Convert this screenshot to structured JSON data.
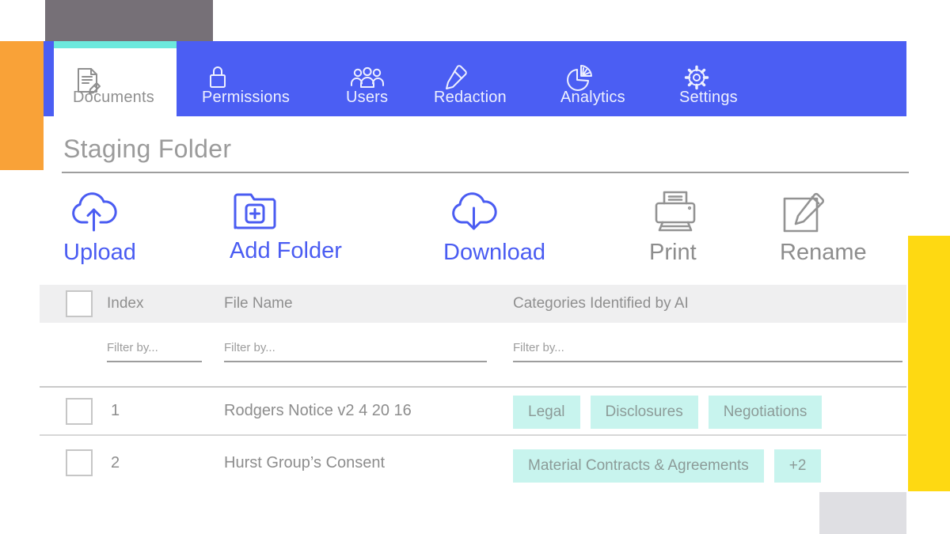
{
  "nav": {
    "tabs": [
      {
        "label": "Documents",
        "icon": "document-edit-icon",
        "active": true
      },
      {
        "label": "Permissions",
        "icon": "lock-icon",
        "active": false
      },
      {
        "label": "Users",
        "icon": "users-icon",
        "active": false
      },
      {
        "label": "Redaction",
        "icon": "highlighter-icon",
        "active": false
      },
      {
        "label": "Analytics",
        "icon": "pie-chart-icon",
        "active": false
      },
      {
        "label": "Settings",
        "icon": "gear-icon",
        "active": false
      }
    ]
  },
  "page": {
    "title": "Staging Folder"
  },
  "toolbar": {
    "actions": [
      {
        "label": "Upload",
        "icon": "cloud-upload-icon",
        "style": "primary"
      },
      {
        "label": "Add Folder",
        "icon": "folder-plus-icon",
        "style": "primary"
      },
      {
        "label": "Download",
        "icon": "cloud-download-icon",
        "style": "primary"
      },
      {
        "label": "Print",
        "icon": "printer-icon",
        "style": "secondary"
      },
      {
        "label": "Rename",
        "icon": "edit-square-icon",
        "style": "secondary"
      }
    ]
  },
  "table": {
    "columns": [
      "Index",
      "File Name",
      "Categories Identified by AI"
    ],
    "filter_placeholder": "Filter by...",
    "rows": [
      {
        "index": "1",
        "file_name": "Rodgers Notice v2 4 20 16",
        "tags": [
          "Legal",
          "Disclosures",
          "Negotiations"
        ]
      },
      {
        "index": "2",
        "file_name": "Hurst Group’s Consent",
        "tags": [
          "Material Contracts & Agreements",
          "+2"
        ]
      }
    ]
  },
  "colors": {
    "nav_blue": "#4b5ef3",
    "tab_active_accent_teal": "#6ce9dd",
    "action_primary_blue": "#4a5cf2",
    "action_secondary_gray": "#8d8d8d",
    "tag_background_mint": "#c8f4ee",
    "decor_orange": "#f9a238",
    "decor_yellow": "#fed912",
    "decor_gray_dark": "#767077",
    "decor_gray_light": "#dfdfe3",
    "header_row_gray": "#efeff0"
  }
}
